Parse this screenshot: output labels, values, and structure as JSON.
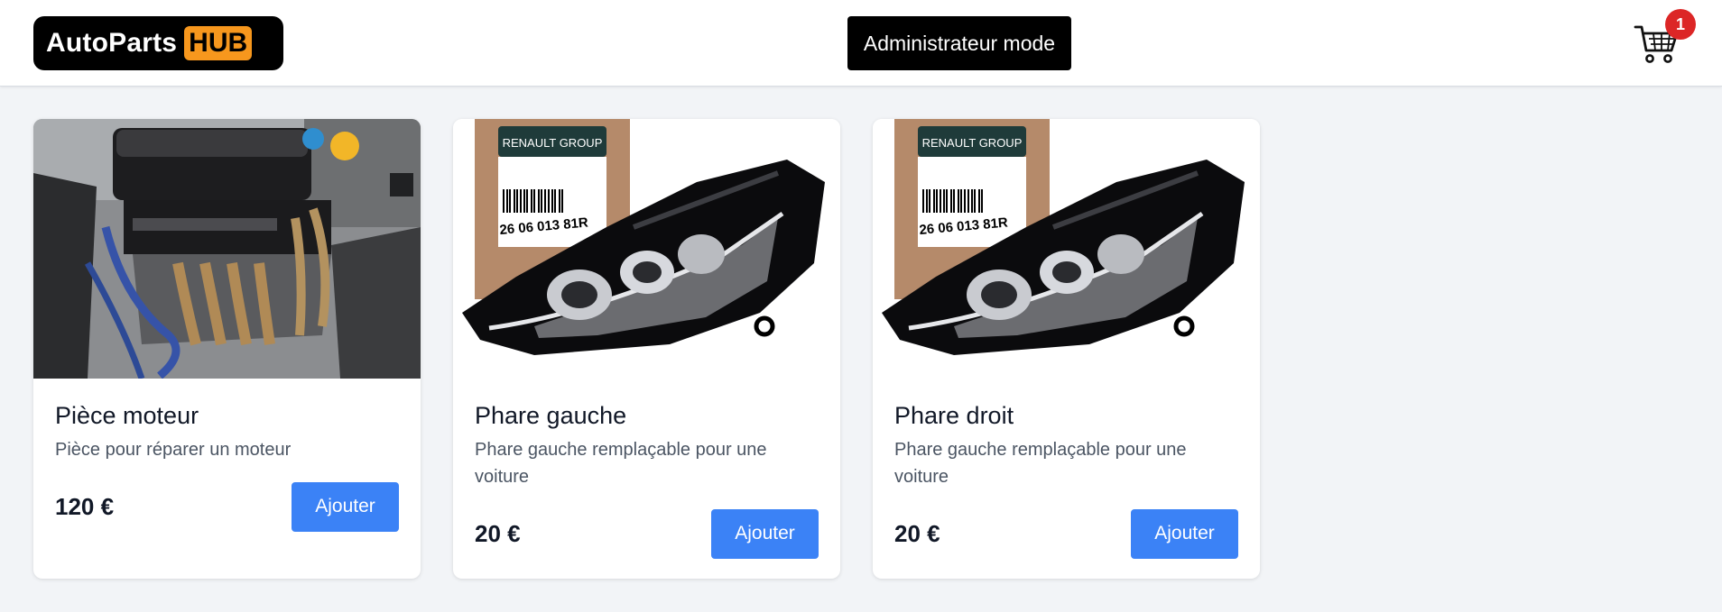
{
  "header": {
    "logo": {
      "text": "AutoParts",
      "badge": "HUB"
    },
    "admin_button": "Administrateur mode",
    "cart": {
      "icon": "cart-icon",
      "count": "1"
    }
  },
  "colors": {
    "accent": "#3b82f6",
    "logo_badge": "#f7971d",
    "cart_badge": "#dc2626",
    "page_bg": "#f2f4f7"
  },
  "products": [
    {
      "image": "engine-image",
      "title": "Pièce moteur",
      "description": "Pièce pour réparer un moteur",
      "price": "120 €",
      "button": "Ajouter"
    },
    {
      "image": "headlight-image",
      "image_text": {
        "brand": "RENAULT GROUP",
        "ref": "26 06 013 81R"
      },
      "title": "Phare gauche",
      "description": "Phare gauche remplaçable pour une voiture",
      "price": "20 €",
      "button": "Ajouter"
    },
    {
      "image": "headlight-image",
      "image_text": {
        "brand": "RENAULT GROUP",
        "ref": "26 06 013 81R"
      },
      "title": "Phare droit",
      "description": "Phare gauche remplaçable pour une voiture",
      "price": "20 €",
      "button": "Ajouter"
    }
  ]
}
